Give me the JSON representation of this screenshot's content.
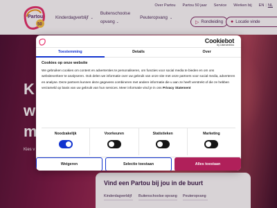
{
  "brand": {
    "logo_text": "Partou",
    "logo_badge": "50"
  },
  "top_links": [
    "Over Partou",
    "Partou 50 jaar",
    "Service",
    "Werken bij"
  ],
  "languages": {
    "en": "EN",
    "sep": "|",
    "nl": "NL"
  },
  "nav": {
    "kinderdagverblijf": "Kinderdagverblijf",
    "bso_line1": "Buitenschoolse",
    "bso_line2": "opvang",
    "peuteropvang": "Peuteropvang",
    "rondleiding": "Rondleiding",
    "locatie": "Locatie vinde"
  },
  "hero": {
    "line1": "K",
    "line2": "w",
    "line3": "m",
    "sub": "Kies v"
  },
  "search": {
    "title": "Vind een Partou bij jou in de buurt",
    "tabs": [
      "Kinderdagverblijf",
      "Buitenschoolse opvang",
      "Peuteropvang"
    ]
  },
  "cookie": {
    "brand": "Cookiebot",
    "by": "by Usercentrics",
    "tabs": [
      "Toestemming",
      "Details",
      "Over"
    ],
    "heading": "Cookies op onze website",
    "body": "We gebruiken cookies om content en advertenties te personaliseren, om functies voor social media te bieden en om ons websiteverkeer te analyseren. Ook delen we informatie over uw gebruik van onze site met onze partners voor social media, adverteren en analyse. Deze partners kunnen deze gegevens combineren met andere informatie die u aan ze heeft verstrekt of die ze hebben verzameld op basis van uw gebruik van hun services. Meer informatie vind je in ons",
    "link": "Privacy Statement",
    "toggles": [
      {
        "label": "Noodzakelijk",
        "state": "on"
      },
      {
        "label": "Voorkeuren",
        "state": "off"
      },
      {
        "label": "Statistieken",
        "state": "off"
      },
      {
        "label": "Marketing",
        "state": "off"
      }
    ],
    "buttons": {
      "deny": "Weigeren",
      "selection": "Selectie toestaan",
      "all": "Alles toestaan"
    }
  },
  "colors": {
    "accent_blue": "#1032cf",
    "brand_magenta": "#b0205a",
    "brand_purple": "#4a2a5a"
  }
}
